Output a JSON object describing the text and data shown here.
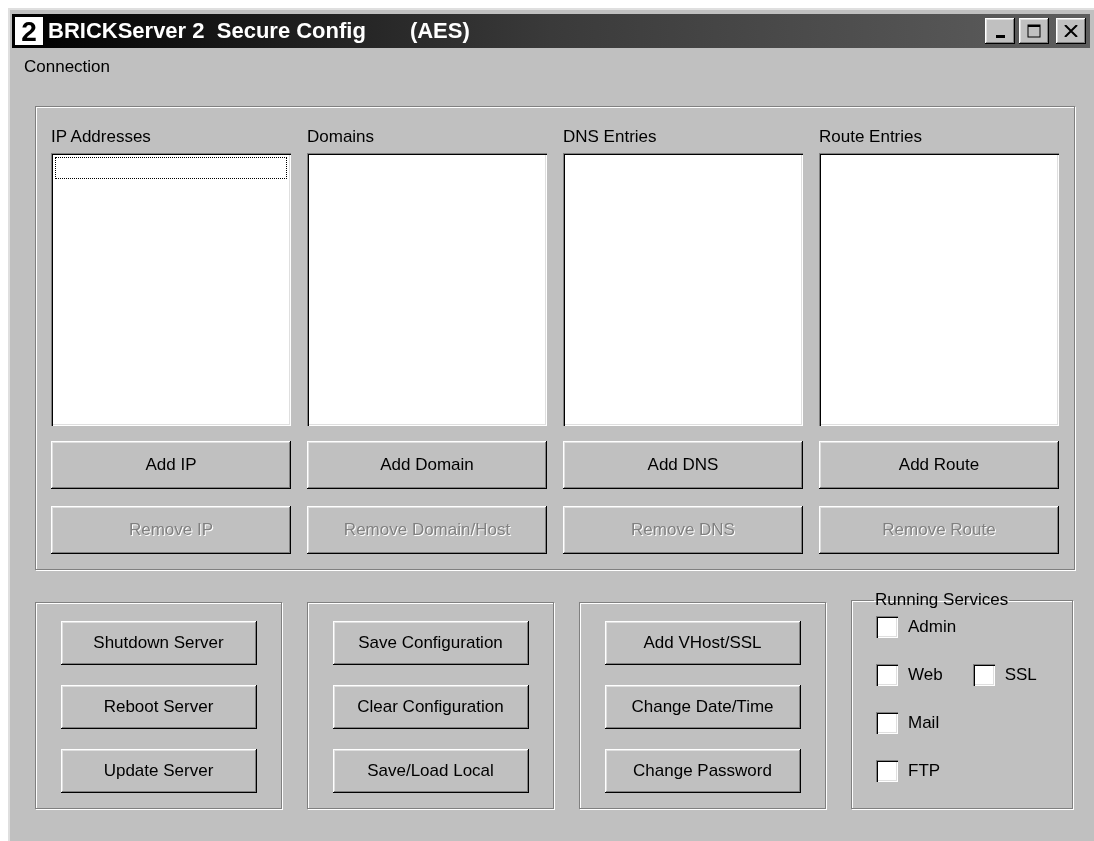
{
  "window": {
    "icon_glyph": "2",
    "title": "BRICKServer 2  Secure Config",
    "title_suffix": "(AES)"
  },
  "menu": [
    {
      "label": "Connection"
    }
  ],
  "lists": [
    {
      "label": "IP Addresses",
      "focused": true,
      "add_button": {
        "label": "Add IP",
        "disabled": false
      },
      "remove_button": {
        "label": "Remove IP",
        "disabled": true
      }
    },
    {
      "label": "Domains",
      "focused": false,
      "add_button": {
        "label": "Add Domain",
        "disabled": false
      },
      "remove_button": {
        "label": "Remove Domain/Host",
        "disabled": true
      }
    },
    {
      "label": "DNS Entries",
      "focused": false,
      "add_button": {
        "label": "Add DNS",
        "disabled": false
      },
      "remove_button": {
        "label": "Remove DNS",
        "disabled": true
      }
    },
    {
      "label": "Route Entries",
      "focused": false,
      "add_button": {
        "label": "Add Route",
        "disabled": false
      },
      "remove_button": {
        "label": "Remove Route",
        "disabled": true
      }
    }
  ],
  "button_groups": [
    {
      "buttons": [
        "Shutdown Server",
        "Reboot Server",
        "Update Server"
      ]
    },
    {
      "buttons": [
        "Save Configuration",
        "Clear Configuration",
        "Save/Load Local"
      ]
    },
    {
      "buttons": [
        "Add VHost/SSL",
        "Change Date/Time",
        "Change Password"
      ]
    }
  ],
  "running_services": {
    "title": "Running Services",
    "rows": [
      {
        "items": [
          {
            "label": "Admin",
            "checked": false
          }
        ]
      },
      {
        "items": [
          {
            "label": "Web",
            "checked": false
          },
          {
            "label": "SSL",
            "checked": false
          }
        ]
      },
      {
        "items": [
          {
            "label": "Mail",
            "checked": false
          }
        ]
      },
      {
        "items": [
          {
            "label": "FTP",
            "checked": false
          }
        ]
      }
    ]
  }
}
